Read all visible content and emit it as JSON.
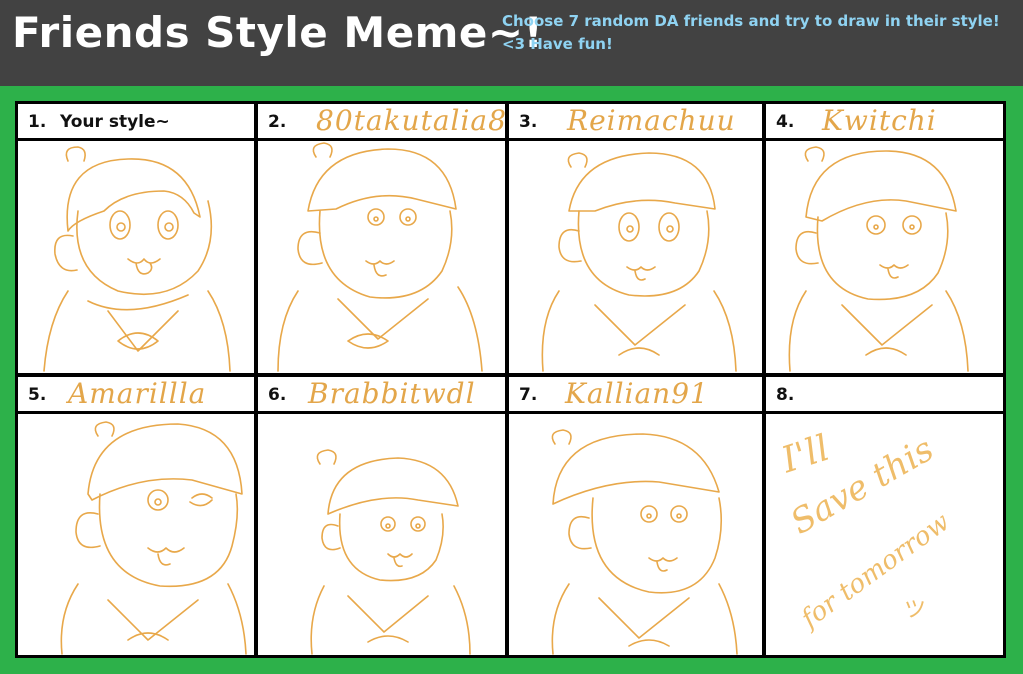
{
  "header": {
    "title": "Friends Style Meme~!",
    "subtitle": "Choose 7 random DA friends and try to draw in their style! <3 Have fun!"
  },
  "colors": {
    "header_bg": "#424242",
    "frame_green": "#2db14a",
    "subtitle": "#8fd3f2",
    "sketch": "#e8a84a"
  },
  "panels": [
    {
      "number": "1.",
      "label": "Your style~",
      "name": ""
    },
    {
      "number": "2.",
      "label": "",
      "name": "80takutalia8"
    },
    {
      "number": "3.",
      "label": "",
      "name": "Reimachuu"
    },
    {
      "number": "4.",
      "label": "",
      "name": "Kwitchi"
    },
    {
      "number": "5.",
      "label": "",
      "name": "Amarillla"
    },
    {
      "number": "6.",
      "label": "",
      "name": "Brabbitwdl"
    },
    {
      "number": "7.",
      "label": "",
      "name": "Kallian91"
    },
    {
      "number": "8.",
      "label": "",
      "name": ""
    }
  ],
  "panel8_note": {
    "line1": "I'll",
    "line2": "Save this",
    "line3": "for tomorrow",
    "emoticon": "ツ"
  }
}
